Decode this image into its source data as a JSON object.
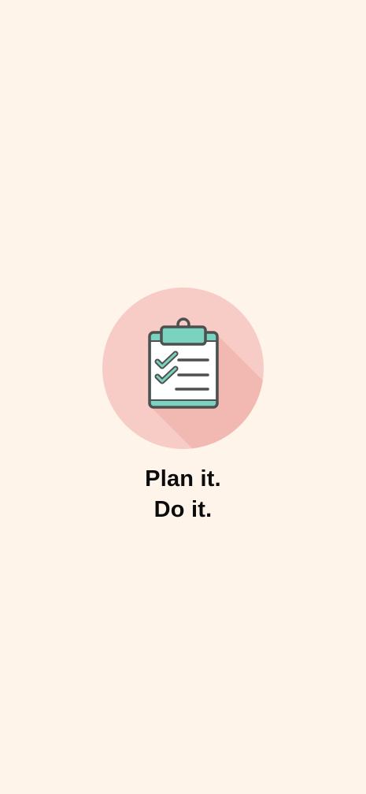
{
  "splash": {
    "logo_icon": "clipboard-checklist-icon",
    "tagline_line1": "Plan it.",
    "tagline_line2": "Do it."
  },
  "colors": {
    "background": "#FEF4EA",
    "circle": "#F8CCC6",
    "shadow": "#F0B2AB",
    "clipboard_teal": "#79D3BE",
    "outline": "#4F4F4F",
    "paper": "#FFFFFF",
    "text": "#0B0B0B"
  }
}
